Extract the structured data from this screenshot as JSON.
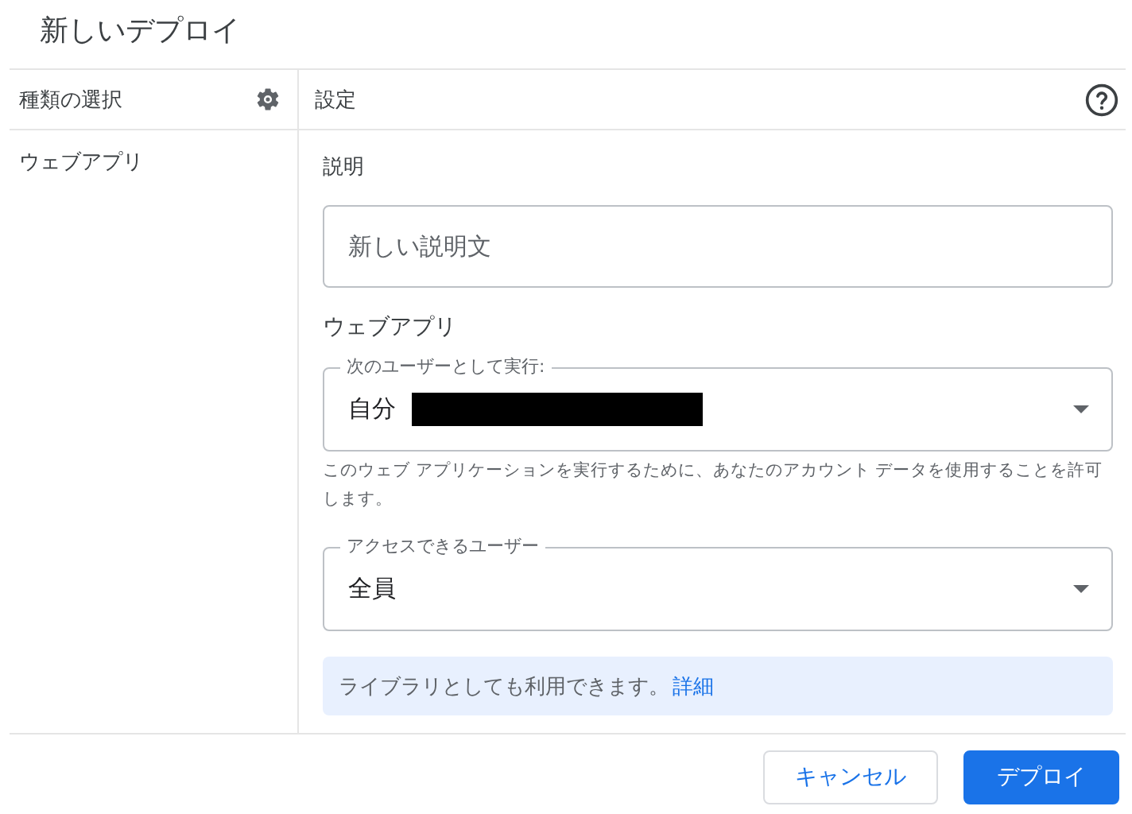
{
  "dialog": {
    "title": "新しいデプロイ"
  },
  "sidebar": {
    "heading": "種類の選択",
    "items": [
      {
        "label": "ウェブアプリ",
        "selected": false
      }
    ]
  },
  "panel": {
    "heading": "設定",
    "description": {
      "label": "説明",
      "placeholder": "新しい説明文"
    },
    "section": "ウェブアプリ",
    "selects": [
      {
        "label": "次のユーザーとして実行:",
        "value": "自分",
        "redacted": true,
        "hint": "このウェブ アプリケーションを実行するために、あなたのアカウント データを使用することを許可します。"
      },
      {
        "label": "アクセスできるユーザー",
        "value": "全員",
        "redacted": false
      }
    ],
    "info": {
      "text": "ライブラリとしても利用できます。",
      "link": "詳細"
    }
  },
  "buttons": [
    {
      "label": "キャンセル",
      "kind": "secondary"
    },
    {
      "label": "デプロイ",
      "kind": "primary"
    }
  ]
}
